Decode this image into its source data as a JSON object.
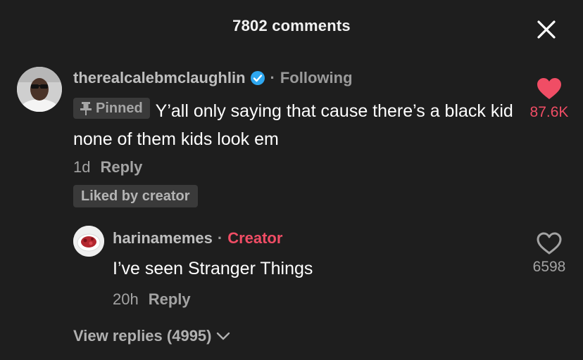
{
  "header": {
    "title": "7802 comments",
    "close_icon": "close-icon"
  },
  "colors": {
    "background": "#1e1e1e",
    "like_active": "#f04d65",
    "verified": "#2ea7f0",
    "creator": "#f04d65"
  },
  "comment": {
    "username": "therealcalebmclaughlin",
    "verified_icon": "verified-check-icon",
    "following": "Following",
    "pinned_label": "Pinned",
    "text": "Y’all only saying that cause there’s a black kid none of them kids look em",
    "time": "1d",
    "reply_label": "Reply",
    "liked_by": "Liked by creator",
    "like_count": "87.6K",
    "liked": true
  },
  "reply": {
    "username": "harinamemes",
    "creator_label": "Creator",
    "text": "I’ve seen Stranger Things",
    "time": "20h",
    "reply_label": "Reply",
    "like_count": "6598",
    "liked": false
  },
  "view_replies": {
    "label": "View replies (4995)"
  }
}
